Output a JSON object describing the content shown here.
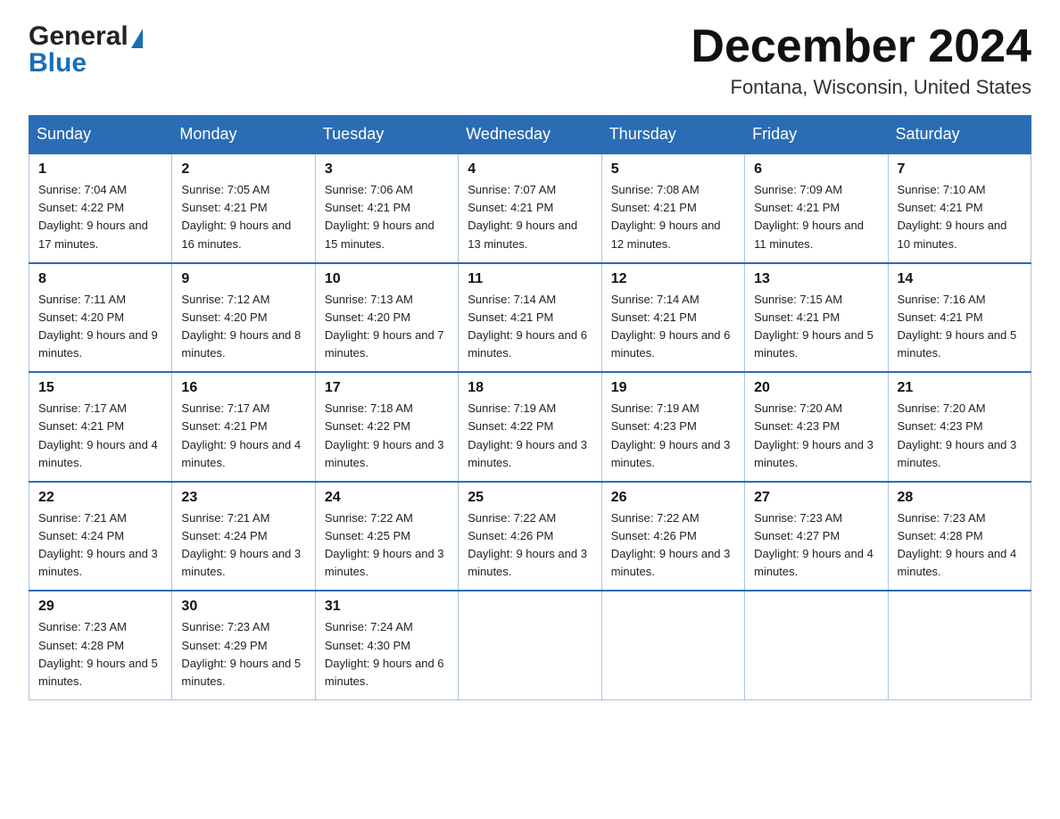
{
  "logo": {
    "line1": "General",
    "line2": "Blue"
  },
  "title": "December 2024",
  "location": "Fontana, Wisconsin, United States",
  "days_of_week": [
    "Sunday",
    "Monday",
    "Tuesday",
    "Wednesday",
    "Thursday",
    "Friday",
    "Saturday"
  ],
  "weeks": [
    [
      {
        "day": "1",
        "sunrise": "Sunrise: 7:04 AM",
        "sunset": "Sunset: 4:22 PM",
        "daylight": "Daylight: 9 hours and 17 minutes."
      },
      {
        "day": "2",
        "sunrise": "Sunrise: 7:05 AM",
        "sunset": "Sunset: 4:21 PM",
        "daylight": "Daylight: 9 hours and 16 minutes."
      },
      {
        "day": "3",
        "sunrise": "Sunrise: 7:06 AM",
        "sunset": "Sunset: 4:21 PM",
        "daylight": "Daylight: 9 hours and 15 minutes."
      },
      {
        "day": "4",
        "sunrise": "Sunrise: 7:07 AM",
        "sunset": "Sunset: 4:21 PM",
        "daylight": "Daylight: 9 hours and 13 minutes."
      },
      {
        "day": "5",
        "sunrise": "Sunrise: 7:08 AM",
        "sunset": "Sunset: 4:21 PM",
        "daylight": "Daylight: 9 hours and 12 minutes."
      },
      {
        "day": "6",
        "sunrise": "Sunrise: 7:09 AM",
        "sunset": "Sunset: 4:21 PM",
        "daylight": "Daylight: 9 hours and 11 minutes."
      },
      {
        "day": "7",
        "sunrise": "Sunrise: 7:10 AM",
        "sunset": "Sunset: 4:21 PM",
        "daylight": "Daylight: 9 hours and 10 minutes."
      }
    ],
    [
      {
        "day": "8",
        "sunrise": "Sunrise: 7:11 AM",
        "sunset": "Sunset: 4:20 PM",
        "daylight": "Daylight: 9 hours and 9 minutes."
      },
      {
        "day": "9",
        "sunrise": "Sunrise: 7:12 AM",
        "sunset": "Sunset: 4:20 PM",
        "daylight": "Daylight: 9 hours and 8 minutes."
      },
      {
        "day": "10",
        "sunrise": "Sunrise: 7:13 AM",
        "sunset": "Sunset: 4:20 PM",
        "daylight": "Daylight: 9 hours and 7 minutes."
      },
      {
        "day": "11",
        "sunrise": "Sunrise: 7:14 AM",
        "sunset": "Sunset: 4:21 PM",
        "daylight": "Daylight: 9 hours and 6 minutes."
      },
      {
        "day": "12",
        "sunrise": "Sunrise: 7:14 AM",
        "sunset": "Sunset: 4:21 PM",
        "daylight": "Daylight: 9 hours and 6 minutes."
      },
      {
        "day": "13",
        "sunrise": "Sunrise: 7:15 AM",
        "sunset": "Sunset: 4:21 PM",
        "daylight": "Daylight: 9 hours and 5 minutes."
      },
      {
        "day": "14",
        "sunrise": "Sunrise: 7:16 AM",
        "sunset": "Sunset: 4:21 PM",
        "daylight": "Daylight: 9 hours and 5 minutes."
      }
    ],
    [
      {
        "day": "15",
        "sunrise": "Sunrise: 7:17 AM",
        "sunset": "Sunset: 4:21 PM",
        "daylight": "Daylight: 9 hours and 4 minutes."
      },
      {
        "day": "16",
        "sunrise": "Sunrise: 7:17 AM",
        "sunset": "Sunset: 4:21 PM",
        "daylight": "Daylight: 9 hours and 4 minutes."
      },
      {
        "day": "17",
        "sunrise": "Sunrise: 7:18 AM",
        "sunset": "Sunset: 4:22 PM",
        "daylight": "Daylight: 9 hours and 3 minutes."
      },
      {
        "day": "18",
        "sunrise": "Sunrise: 7:19 AM",
        "sunset": "Sunset: 4:22 PM",
        "daylight": "Daylight: 9 hours and 3 minutes."
      },
      {
        "day": "19",
        "sunrise": "Sunrise: 7:19 AM",
        "sunset": "Sunset: 4:23 PM",
        "daylight": "Daylight: 9 hours and 3 minutes."
      },
      {
        "day": "20",
        "sunrise": "Sunrise: 7:20 AM",
        "sunset": "Sunset: 4:23 PM",
        "daylight": "Daylight: 9 hours and 3 minutes."
      },
      {
        "day": "21",
        "sunrise": "Sunrise: 7:20 AM",
        "sunset": "Sunset: 4:23 PM",
        "daylight": "Daylight: 9 hours and 3 minutes."
      }
    ],
    [
      {
        "day": "22",
        "sunrise": "Sunrise: 7:21 AM",
        "sunset": "Sunset: 4:24 PM",
        "daylight": "Daylight: 9 hours and 3 minutes."
      },
      {
        "day": "23",
        "sunrise": "Sunrise: 7:21 AM",
        "sunset": "Sunset: 4:24 PM",
        "daylight": "Daylight: 9 hours and 3 minutes."
      },
      {
        "day": "24",
        "sunrise": "Sunrise: 7:22 AM",
        "sunset": "Sunset: 4:25 PM",
        "daylight": "Daylight: 9 hours and 3 minutes."
      },
      {
        "day": "25",
        "sunrise": "Sunrise: 7:22 AM",
        "sunset": "Sunset: 4:26 PM",
        "daylight": "Daylight: 9 hours and 3 minutes."
      },
      {
        "day": "26",
        "sunrise": "Sunrise: 7:22 AM",
        "sunset": "Sunset: 4:26 PM",
        "daylight": "Daylight: 9 hours and 3 minutes."
      },
      {
        "day": "27",
        "sunrise": "Sunrise: 7:23 AM",
        "sunset": "Sunset: 4:27 PM",
        "daylight": "Daylight: 9 hours and 4 minutes."
      },
      {
        "day": "28",
        "sunrise": "Sunrise: 7:23 AM",
        "sunset": "Sunset: 4:28 PM",
        "daylight": "Daylight: 9 hours and 4 minutes."
      }
    ],
    [
      {
        "day": "29",
        "sunrise": "Sunrise: 7:23 AM",
        "sunset": "Sunset: 4:28 PM",
        "daylight": "Daylight: 9 hours and 5 minutes."
      },
      {
        "day": "30",
        "sunrise": "Sunrise: 7:23 AM",
        "sunset": "Sunset: 4:29 PM",
        "daylight": "Daylight: 9 hours and 5 minutes."
      },
      {
        "day": "31",
        "sunrise": "Sunrise: 7:24 AM",
        "sunset": "Sunset: 4:30 PM",
        "daylight": "Daylight: 9 hours and 6 minutes."
      },
      null,
      null,
      null,
      null
    ]
  ]
}
